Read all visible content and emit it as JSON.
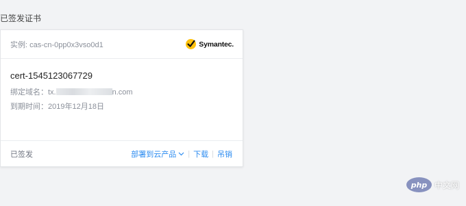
{
  "page": {
    "section_title": "已签发证书"
  },
  "card": {
    "instance_label": "实例: cas-cn-0pp0x3vso0d1",
    "brand": {
      "icon": "symantec-check-icon",
      "name": "Symantec."
    },
    "cert_name": "cert-1545123067729",
    "domain_label": "绑定域名：",
    "domain_prefix": "tx.",
    "domain_suffix": "n.com",
    "expiry_label": "到期时间：",
    "expiry_value": "2019年12月18日",
    "status": "已签发",
    "actions": {
      "deploy": "部署到云产品",
      "download": "下载",
      "revoke": "吊销"
    }
  },
  "watermark": {
    "badge": "php",
    "text": "中文网"
  },
  "colors": {
    "link": "#2d8cf0",
    "background": "#f2f3f5",
    "symantec_yellow": "#ffc20e"
  }
}
